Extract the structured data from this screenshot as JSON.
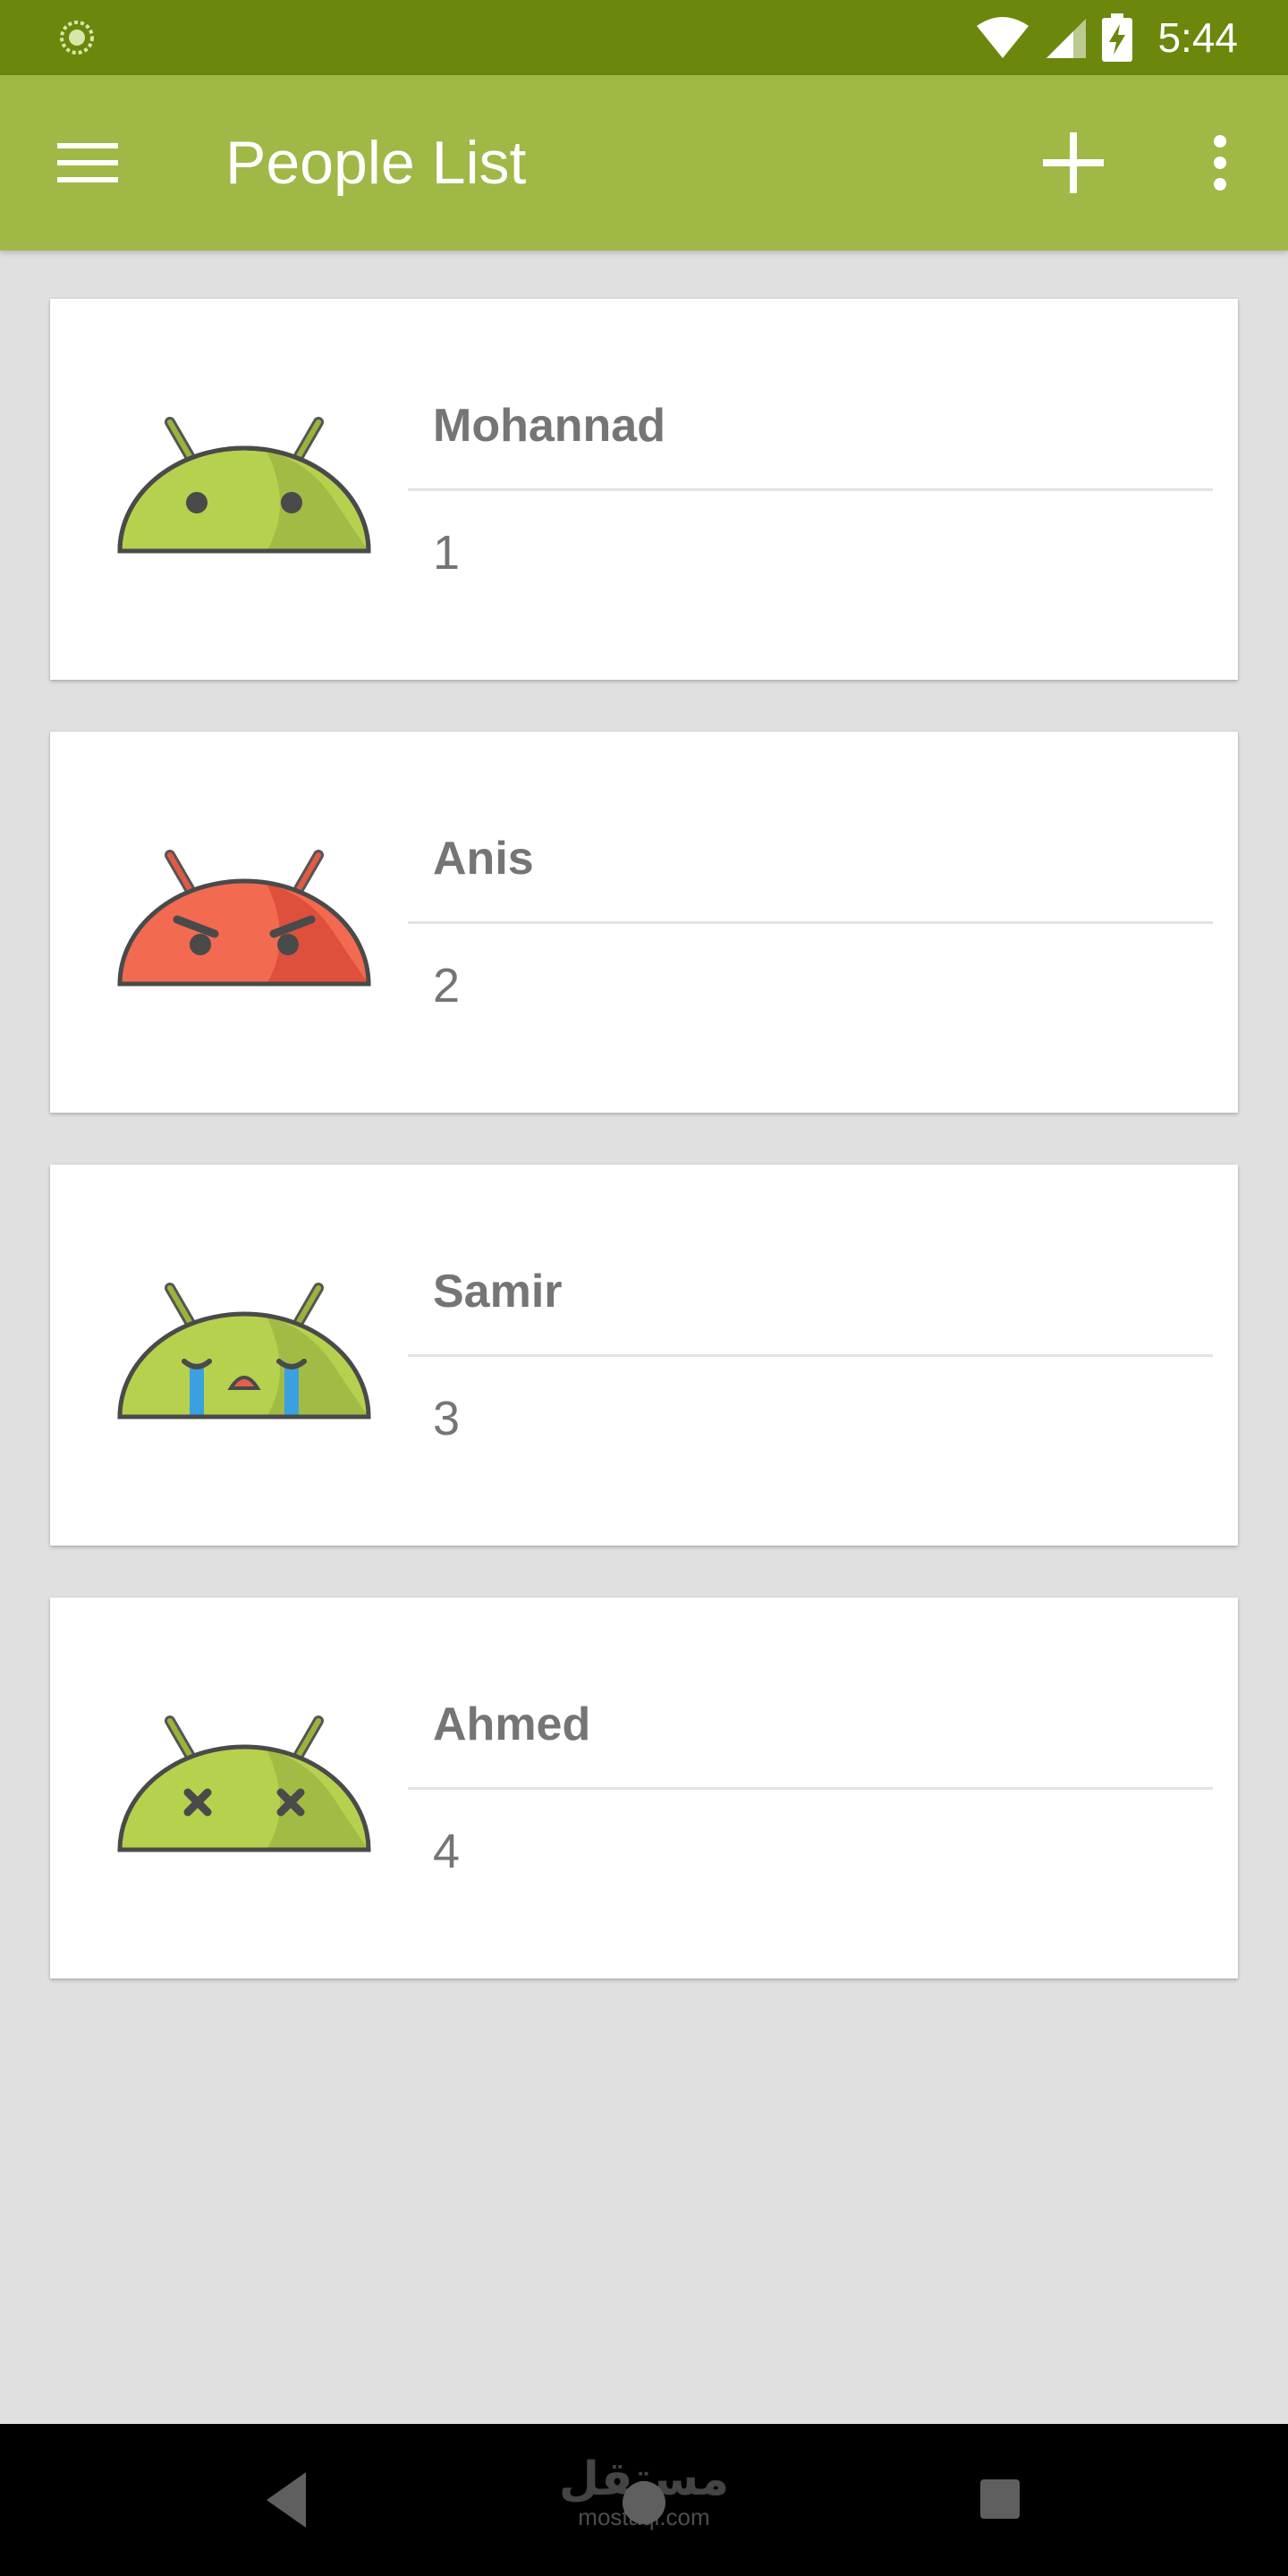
{
  "status_bar": {
    "time": "5:44",
    "icons": [
      "app-notification-icon",
      "wifi-icon",
      "cellular-signal-icon",
      "battery-charging-icon"
    ]
  },
  "app_bar": {
    "title": "People List",
    "menu_icon": "hamburger-menu-icon",
    "add_icon": "plus-icon",
    "more_icon": "more-vert-icon",
    "background_color": "#a0b845",
    "status_color": "#6b870c"
  },
  "people": [
    {
      "name": "Mohannad",
      "number": "1",
      "avatar": "android-neutral-icon",
      "color": "#a4c639"
    },
    {
      "name": "Anis",
      "number": "2",
      "avatar": "android-angry-icon",
      "color": "#f0533c"
    },
    {
      "name": "Samir",
      "number": "3",
      "avatar": "android-crying-icon",
      "color": "#a4c639"
    },
    {
      "name": "Ahmed",
      "number": "4",
      "avatar": "android-dead-icon",
      "color": "#a4c639"
    }
  ],
  "nav_bar": {
    "back_icon": "back-triangle-icon",
    "home_icon": "home-circle-icon",
    "recents_icon": "recents-square-icon"
  },
  "watermark": {
    "main": "مستقل",
    "sub": "mostaql.com"
  }
}
